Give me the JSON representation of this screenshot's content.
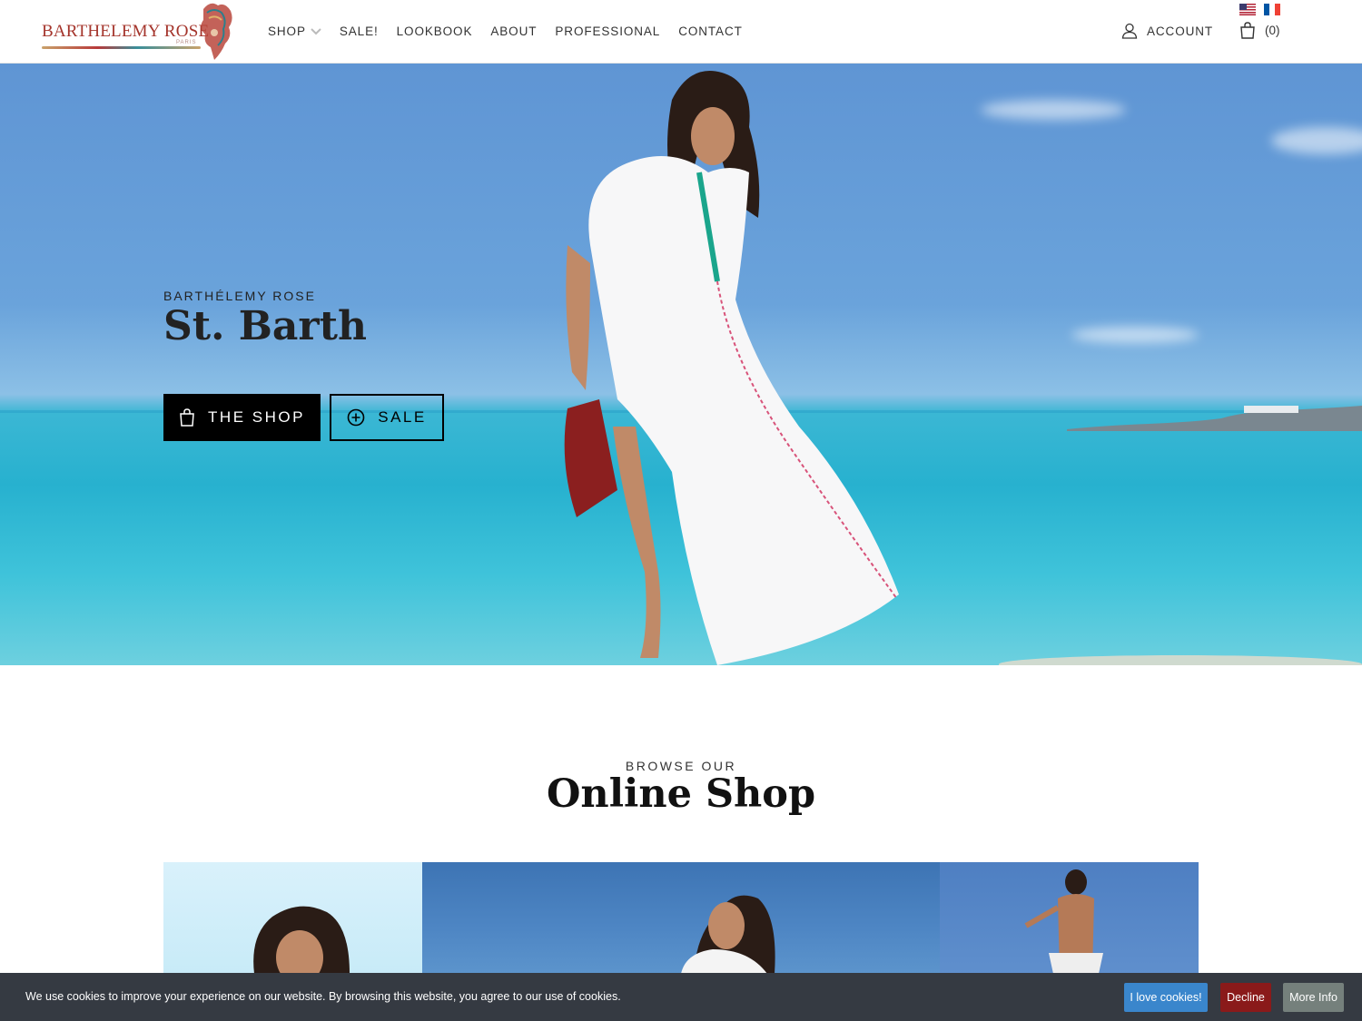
{
  "header": {
    "logo_text": "BARTHELEMY ROSE",
    "logo_sub": "PARIS",
    "nav": [
      {
        "label": "SHOP"
      },
      {
        "label": "SALE!"
      },
      {
        "label": "LOOKBOOK"
      },
      {
        "label": "ABOUT"
      },
      {
        "label": "PROFESSIONAL"
      },
      {
        "label": "CONTACT"
      }
    ],
    "account_label": "ACCOUNT",
    "cart_count": "(0)",
    "icons": {
      "user": "user-icon",
      "bag": "shopping-bag-icon",
      "chevron": "chevron-down-icon"
    },
    "flags": [
      "us-flag-icon",
      "fr-flag-icon"
    ]
  },
  "hero": {
    "eyebrow": "BARTHÉLEMY ROSE",
    "title": "St. Barth",
    "buttons": [
      {
        "label": "THE SHOP",
        "icon": "shopping-bag-icon"
      },
      {
        "label": "SALE",
        "icon": "plus-circle-icon"
      }
    ]
  },
  "browse": {
    "eyebrow": "BROWSE OUR",
    "title": "Online Shop"
  },
  "cookie": {
    "text": "We use cookies to improve your experience on our website. By browsing this website, you agree to our use of cookies.",
    "accept_label": "I love cookies!",
    "decline_label": "Decline",
    "info_label": "More Info"
  },
  "colors": {
    "brand": "#a4342b",
    "accept": "#3a86cc",
    "decline": "#8a1a1a",
    "info": "#75807c",
    "cookie_bg": "#353a42"
  }
}
